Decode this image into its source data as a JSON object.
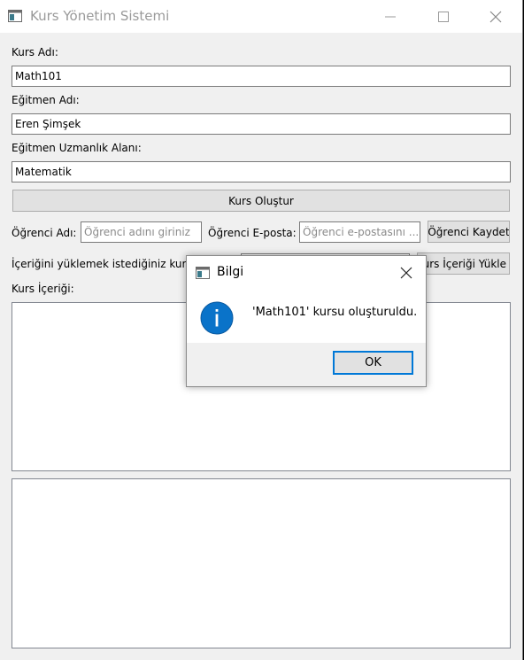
{
  "window": {
    "title": "Kurs Yönetim Sistemi"
  },
  "form": {
    "course_name_label": "Kurs Adı:",
    "course_name_value": "Math101",
    "instructor_name_label": "Eğitmen Adı:",
    "instructor_name_value": "Eren Şimşek",
    "instructor_field_label": "Eğitmen Uzmanlık Alanı:",
    "instructor_field_value": "Matematik",
    "create_course_button": "Kurs Oluştur",
    "student_name_label": "Öğrenci Adı:",
    "student_name_placeholder": "Öğrenci adını giriniz",
    "student_email_label": "Öğrenci E-posta:",
    "student_email_placeholder": "Öğrenci e-postasını ...",
    "register_student_button": "Öğrenci Kaydet",
    "content_course_label": "İçeriğini yüklemek istediğiniz kurs n",
    "load_content_button": "urs İçeriği Yükle",
    "course_content_label": "Kurs İçeriği:"
  },
  "dialog": {
    "title": "Bilgi",
    "message": "'Math101' kursu oluşturuldu.",
    "ok_label": "OK",
    "icon": "info-icon",
    "accent_color": "#0078d7"
  }
}
